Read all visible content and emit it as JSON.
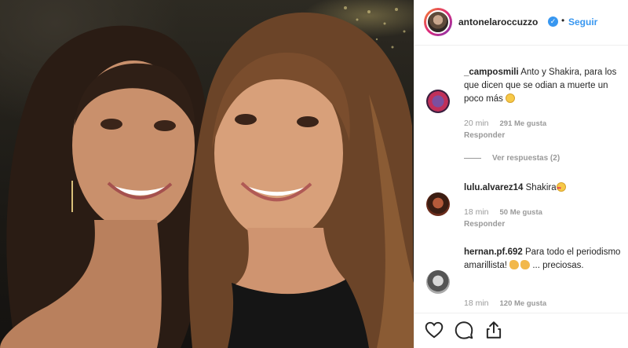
{
  "post": {
    "username": "antonelaroccuzzo",
    "verified_icon": "verified-badge-icon",
    "separator": "•",
    "follow_label": "Seguir"
  },
  "comments": [
    {
      "user": "_camposmili",
      "text": " Anto y Shakira, para los que dicen que se odian a muerte un poco más ",
      "emoji": "laughing-emoji-icon",
      "time": "20 min",
      "likes": "291 Me gusta",
      "reply": "Responder",
      "view_replies": "Ver respuestas (2)"
    },
    {
      "user": "lulu.alvarez14",
      "text": " Shakira",
      "emoji": "heart-eyes-emoji-icon",
      "time": "18 min",
      "likes": "50 Me gusta",
      "reply": "Responder"
    },
    {
      "user": "hernan.pf.692",
      "text": " Para todo el periodismo amarillista! ",
      "text_after": " ... preciosas.",
      "emoji": "clapping-hands-emoji-icon",
      "time": "18 min",
      "likes": "120 Me gusta"
    }
  ],
  "actions": {
    "like_icon": "heart-icon",
    "comment_icon": "comment-bubble-icon",
    "share_icon": "share-icon"
  },
  "colors": {
    "link_blue": "#3897f0",
    "text": "#262626",
    "muted": "#999999",
    "border": "#efefef"
  }
}
